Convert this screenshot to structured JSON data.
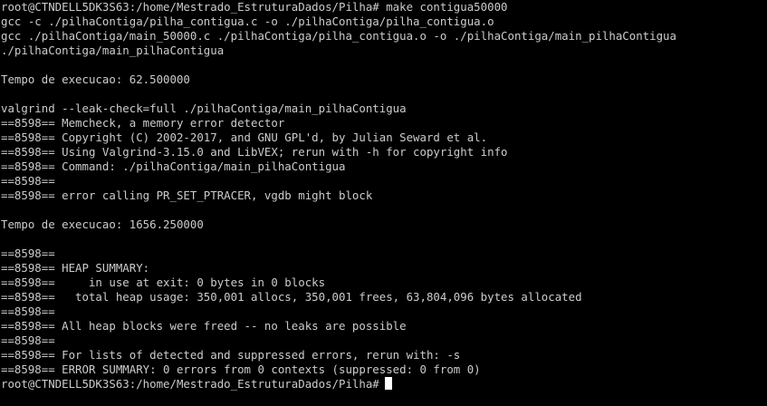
{
  "terminal": {
    "lines": [
      "root@CTNDELL5DK3S63:/home/Mestrado_EstruturaDados/Pilha# make contigua50000",
      "gcc -c ./pilhaContiga/pilha_contigua.c -o ./pilhaContiga/pilha_contigua.o",
      "gcc ./pilhaContiga/main_50000.c ./pilhaContiga/pilha_contigua.o -o ./pilhaContiga/main_pilhaContigua",
      "./pilhaContiga/main_pilhaContigua",
      "",
      "Tempo de execucao: 62.500000",
      "",
      "valgrind --leak-check=full ./pilhaContiga/main_pilhaContigua",
      "==8598== Memcheck, a memory error detector",
      "==8598== Copyright (C) 2002-2017, and GNU GPL'd, by Julian Seward et al.",
      "==8598== Using Valgrind-3.15.0 and LibVEX; rerun with -h for copyright info",
      "==8598== Command: ./pilhaContiga/main_pilhaContigua",
      "==8598==",
      "==8598== error calling PR_SET_PTRACER, vgdb might block",
      "",
      "Tempo de execucao: 1656.250000",
      "",
      "==8598==",
      "==8598== HEAP SUMMARY:",
      "==8598==     in use at exit: 0 bytes in 0 blocks",
      "==8598==   total heap usage: 350,001 allocs, 350,001 frees, 63,804,096 bytes allocated",
      "==8598==",
      "==8598== All heap blocks were freed -- no leaks are possible",
      "==8598==",
      "==8598== For lists of detected and suppressed errors, rerun with: -s",
      "==8598== ERROR SUMMARY: 0 errors from 0 contexts (suppressed: 0 from 0)"
    ],
    "prompt": "root@CTNDELL5DK3S63:/home/Mestrado_EstruturaDados/Pilha#",
    "colors": {
      "background": "#000000",
      "text": "#cccccc",
      "cursor": "#ffffff"
    }
  }
}
